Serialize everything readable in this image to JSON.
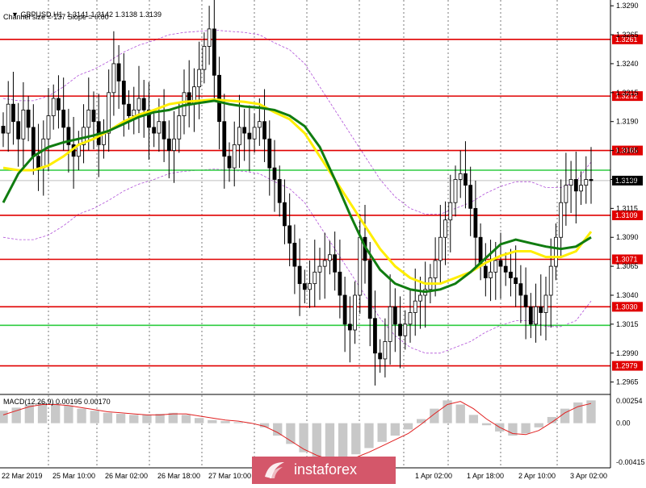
{
  "header": {
    "line1": "GBPUSD,H1  1.3141 1.3142 1.3138 1.3139",
    "line2": "Channel size = 137 Slope = 0.00"
  },
  "brand": "instaforex",
  "macd_label": "MACD(12,26,9) 0.00195 0.00170",
  "colors": {
    "resistance": "#e00000",
    "channel_line": "#2ecc40",
    "ma_slow": "#107c10",
    "ma_fast": "#ffee00",
    "envelope": "#b050d8",
    "macd_hist": "#c8c8c8",
    "macd_signal": "#e02020",
    "brand_bg": "#d4576a"
  },
  "chart_data": {
    "type": "candlestick",
    "symbol": "GBPUSD",
    "timeframe": "H1",
    "ohlc_current": {
      "open": 1.3141,
      "high": 1.3142,
      "low": 1.3138,
      "close": 1.3139
    },
    "price_axis_ticks": [
      "1.3290",
      "1.3265",
      "1.3240",
      "1.3215",
      "1.3190",
      "1.3165",
      "1.3140",
      "1.3115",
      "1.3090",
      "1.3065",
      "1.3040",
      "1.3015",
      "1.2990",
      "1.2965"
    ],
    "ylim": [
      1.2955,
      1.3295
    ],
    "time_labels": [
      "22 Mar 2019",
      "25 Mar 10:00",
      "26 Mar 02:00",
      "26 Mar 18:00",
      "27 Mar 10:00",
      "",
      "",
      "",
      "1 Apr 02:00",
      "1 Apr 18:00",
      "2 Apr 10:00",
      "3 Apr 02:00"
    ],
    "levels": [
      {
        "label": "1.3261",
        "value": 1.3261,
        "kind": "resistance"
      },
      {
        "label": "1.3212",
        "value": 1.3212,
        "kind": "resistance"
      },
      {
        "label": "1.3165",
        "value": 1.3165,
        "kind": "resistance"
      },
      {
        "label": "1.3109",
        "value": 1.3109,
        "kind": "resistance"
      },
      {
        "label": "1.3071",
        "value": 1.3071,
        "kind": "resistance"
      },
      {
        "label": "1.3030",
        "value": 1.303,
        "kind": "resistance"
      },
      {
        "label": "1.2979",
        "value": 1.2979,
        "kind": "resistance"
      },
      {
        "label": "",
        "value": 1.3148,
        "kind": "channel"
      },
      {
        "label": "",
        "value": 1.3014,
        "kind": "channel"
      }
    ],
    "current_price_label": "1.3139",
    "hidden_price_label": "1.3147",
    "price_path": [
      1.318,
      1.3205,
      1.319,
      1.3175,
      1.32,
      1.3185,
      1.316,
      1.315,
      1.3175,
      1.3195,
      1.321,
      1.32,
      1.3185,
      1.317,
      1.316,
      1.317,
      1.3185,
      1.32,
      1.319,
      1.317,
      1.318,
      1.3215,
      1.324,
      1.3225,
      1.3205,
      1.3195,
      1.32,
      1.321,
      1.32,
      1.3185,
      1.318,
      1.319,
      1.3175,
      1.3165,
      1.3175,
      1.3195,
      1.3215,
      1.3205,
      1.322,
      1.3235,
      1.3255,
      1.327,
      1.323,
      1.319,
      1.316,
      1.315,
      1.317,
      1.3185,
      1.318,
      1.3175,
      1.3185,
      1.319,
      1.3175,
      1.315,
      1.314,
      1.312,
      1.31,
      1.3085,
      1.3065,
      1.305,
      1.3045,
      1.305,
      1.306,
      1.3065,
      1.307,
      1.3075,
      1.306,
      1.304,
      1.3015,
      1.301,
      1.304,
      1.309,
      1.307,
      1.302,
      1.299,
      1.2985,
      1.3,
      1.303,
      1.3015,
      1.3005,
      1.3015,
      1.3025,
      1.3035,
      1.304,
      1.3045,
      1.3055,
      1.307,
      1.309,
      1.3105,
      1.312,
      1.314,
      1.3145,
      1.3135,
      1.3115,
      1.309,
      1.3065,
      1.3055,
      1.306,
      1.307,
      1.3065,
      1.306,
      1.3055,
      1.305,
      1.304,
      1.303,
      1.3015,
      1.303,
      1.3025,
      1.304,
      1.3065,
      1.309,
      1.312,
      1.3135,
      1.314,
      1.313,
      1.3135,
      1.314,
      1.3139
    ],
    "ma_slow_path": [
      1.312,
      1.3145,
      1.316,
      1.3168,
      1.3172,
      1.3175,
      1.3178,
      1.3182,
      1.3188,
      1.3194,
      1.3198,
      1.32,
      1.3204,
      1.3206,
      1.3208,
      1.3205,
      1.3203,
      1.3202,
      1.32,
      1.3195,
      1.3186,
      1.3168,
      1.314,
      1.311,
      1.3082,
      1.3062,
      1.305,
      1.3045,
      1.3043,
      1.3045,
      1.305,
      1.306,
      1.3072,
      1.3084,
      1.3088,
      1.3085,
      1.3082,
      1.308,
      1.3082,
      1.309
    ],
    "ma_fast_path": [
      1.315,
      1.3148,
      1.3148,
      1.3152,
      1.316,
      1.317,
      1.3175,
      1.3182,
      1.319,
      1.3196,
      1.32,
      1.3205,
      1.3207,
      1.3208,
      1.3209,
      1.3208,
      1.3207,
      1.3205,
      1.3198,
      1.3192,
      1.318,
      1.316,
      1.314,
      1.312,
      1.31,
      1.308,
      1.3065,
      1.3055,
      1.305,
      1.305,
      1.3055,
      1.306,
      1.3068,
      1.3074,
      1.3078,
      1.3078,
      1.3073,
      1.3073,
      1.3078,
      1.3095
    ],
    "macd": {
      "value": 0.00195,
      "signal": 0.0017,
      "ylim": [
        -0.00415,
        0.00254
      ],
      "ticks": [
        "0.00254",
        "0.00",
        "-0.00415"
      ],
      "histogram": [
        0.0012,
        0.0015,
        0.0018,
        0.002,
        0.0019,
        0.0017,
        0.0014,
        0.0012,
        0.001,
        0.0009,
        0.0008,
        0.0008,
        0.0009,
        0.001,
        0.0008,
        0.0005,
        0.0003,
        0.0002,
        0.0001,
        0.0,
        -0.0004,
        -0.0012,
        -0.002,
        -0.0028,
        -0.0034,
        -0.0038,
        -0.0036,
        -0.003,
        -0.0024,
        -0.0018,
        -0.0012,
        -0.0006,
        0.0004,
        0.0014,
        0.0022,
        0.0018,
        0.0008,
        -0.0002,
        -0.0008,
        -0.0012,
        -0.001,
        -0.0004,
        0.0006,
        0.0014,
        0.002,
        0.0022
      ],
      "signal_path": [
        0.0008,
        0.0012,
        0.0016,
        0.0018,
        0.0018,
        0.0017,
        0.0015,
        0.0013,
        0.0011,
        0.001,
        0.0009,
        0.0008,
        0.0008,
        0.0009,
        0.0009,
        0.0007,
        0.0005,
        0.0003,
        0.0002,
        0.0,
        -0.0003,
        -0.0009,
        -0.0017,
        -0.0025,
        -0.0031,
        -0.0035,
        -0.0036,
        -0.0033,
        -0.0028,
        -0.0022,
        -0.0016,
        -0.001,
        -0.0001,
        0.0009,
        0.0018,
        0.0021,
        0.0014,
        0.0004,
        -0.0004,
        -0.001,
        -0.0011,
        -0.0007,
        0.0001,
        0.001,
        0.0016,
        0.0019
      ]
    }
  }
}
